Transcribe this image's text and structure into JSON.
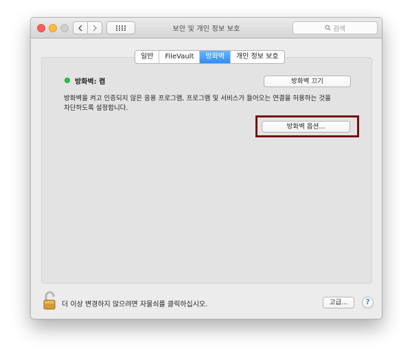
{
  "window": {
    "title": "보안 및 개인 정보 보호",
    "search_placeholder": "검색"
  },
  "tabs": [
    {
      "label": "일반",
      "active": false
    },
    {
      "label": "FileVault",
      "active": false
    },
    {
      "label": "방화벽",
      "active": true
    },
    {
      "label": "개인 정보 보호",
      "active": false
    }
  ],
  "firewall": {
    "status_text": "방화벽: 켬",
    "status_color": "#2ac63f",
    "turn_off_label": "방화벽 끄기",
    "description_line1": "방화벽을 켜고 인증되지 않은 응용 프로그램, 프로그램 및 서비스가 들어오는 연결을 허용하는 것을",
    "description_line2": "차단하도록 설정합니다.",
    "options_label": "방화벽 옵션...",
    "highlight_color": "#6f0f14"
  },
  "footer": {
    "lock_text": "더 이상 변경하지 않으려면 자물쇠를 클릭하십시오.",
    "advanced_label": "고급...",
    "help_label": "?"
  },
  "icons": [
    "chevron-left-icon",
    "chevron-right-icon",
    "grid-icon",
    "search-icon",
    "unlocked-padlock-icon"
  ]
}
